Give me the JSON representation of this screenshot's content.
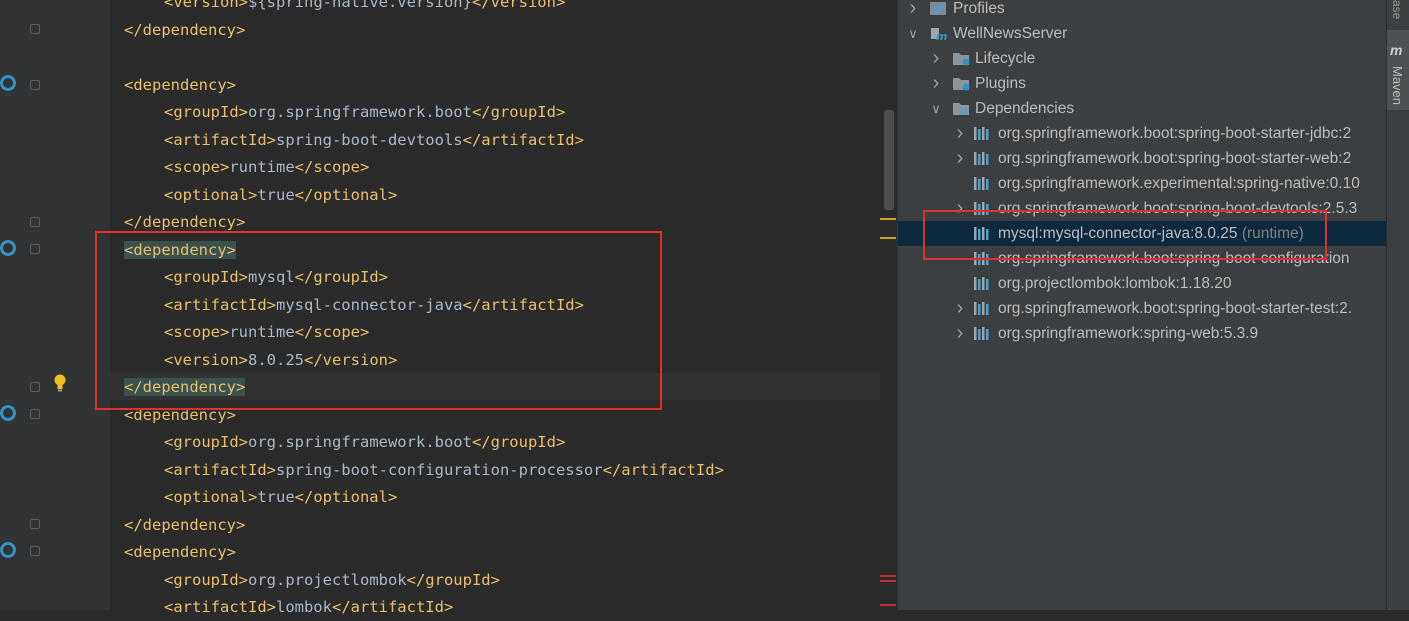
{
  "editor": {
    "lines": [
      {
        "indent": 2,
        "open": "<version>",
        "text": "${spring-native.version}",
        "close": "</version>"
      },
      {
        "indent": 1,
        "open": "",
        "text": "",
        "close": "</dependency>"
      },
      {
        "indent": 1,
        "open": "",
        "text": "",
        "close": ""
      },
      {
        "indent": 1,
        "open": "<dependency>",
        "text": "",
        "close": ""
      },
      {
        "indent": 2,
        "open": "<groupId>",
        "text": "org.springframework.boot",
        "close": "</groupId>"
      },
      {
        "indent": 2,
        "open": "<artifactId>",
        "text": "spring-boot-devtools",
        "close": "</artifactId>"
      },
      {
        "indent": 2,
        "open": "<scope>",
        "text": "runtime",
        "close": "</scope>"
      },
      {
        "indent": 2,
        "open": "<optional>",
        "text": "true",
        "close": "</optional>"
      },
      {
        "indent": 1,
        "open": "",
        "text": "",
        "close": "</dependency>"
      },
      {
        "indent": 1,
        "open": "<dependency>",
        "text": "",
        "close": ""
      },
      {
        "indent": 2,
        "open": "<groupId>",
        "text": "mysql",
        "close": "</groupId>"
      },
      {
        "indent": 2,
        "open": "<artifactId>",
        "text": "mysql-connector-java",
        "close": "</artifactId>"
      },
      {
        "indent": 2,
        "open": "<scope>",
        "text": "runtime",
        "close": "</scope>"
      },
      {
        "indent": 2,
        "open": "<version>",
        "text": "8.0.25",
        "close": "</version>"
      },
      {
        "indent": 1,
        "open": "",
        "text": "",
        "close": "</dependency>"
      },
      {
        "indent": 1,
        "open": "<dependency>",
        "text": "",
        "close": ""
      },
      {
        "indent": 2,
        "open": "<groupId>",
        "text": "org.springframework.boot",
        "close": "</groupId>"
      },
      {
        "indent": 2,
        "open": "<artifactId>",
        "text": "spring-boot-configuration-processor",
        "close": "</artifactId>"
      },
      {
        "indent": 2,
        "open": "<optional>",
        "text": "true",
        "close": "</optional>"
      },
      {
        "indent": 1,
        "open": "",
        "text": "",
        "close": "</dependency>"
      },
      {
        "indent": 1,
        "open": "<dependency>",
        "text": "",
        "close": ""
      },
      {
        "indent": 2,
        "open": "<groupId>",
        "text": "org.projectlombok",
        "close": "</groupId>"
      },
      {
        "indent": 2,
        "open": "<artifactId>",
        "text": "lombok",
        "close": "</artifactId>"
      }
    ]
  },
  "maven": {
    "tool_window_title": "Maven",
    "edge_label": "ase",
    "tree": [
      {
        "level": 0,
        "expander": "closed",
        "icon": "profiles-icon",
        "label": "Profiles",
        "suffix": ""
      },
      {
        "level": 0,
        "expander": "open",
        "icon": "maven-project-icon",
        "label": "WellNewsServer",
        "suffix": ""
      },
      {
        "level": 1,
        "expander": "closed",
        "icon": "lifecycle-folder-icon",
        "label": "Lifecycle",
        "suffix": ""
      },
      {
        "level": 1,
        "expander": "closed",
        "icon": "plugins-folder-icon",
        "label": "Plugins",
        "suffix": ""
      },
      {
        "level": 1,
        "expander": "open",
        "icon": "dependencies-folder-icon",
        "label": "Dependencies",
        "suffix": ""
      },
      {
        "level": 2,
        "expander": "closed",
        "icon": "library-icon",
        "label": "org.springframework.boot:spring-boot-starter-jdbc:2",
        "suffix": ""
      },
      {
        "level": 2,
        "expander": "closed",
        "icon": "library-icon",
        "label": "org.springframework.boot:spring-boot-starter-web:2",
        "suffix": ""
      },
      {
        "level": 2,
        "expander": "none",
        "icon": "library-icon",
        "label": "org.springframework.experimental:spring-native:0.10",
        "suffix": ""
      },
      {
        "level": 2,
        "expander": "closed",
        "icon": "library-icon",
        "label": "org.springframework.boot:spring-boot-devtools:2.5.3",
        "suffix": ""
      },
      {
        "level": 2,
        "expander": "none",
        "icon": "library-icon",
        "label": "mysql:mysql-connector-java:8.0.25",
        "suffix": "(runtime)",
        "selected": true
      },
      {
        "level": 2,
        "expander": "none",
        "icon": "library-icon",
        "label": "org.springframework.boot:spring-boot-configuration",
        "suffix": ""
      },
      {
        "level": 2,
        "expander": "none",
        "icon": "library-icon",
        "label": "org.projectlombok:lombok:1.18.20",
        "suffix": ""
      },
      {
        "level": 2,
        "expander": "closed",
        "icon": "library-icon",
        "label": "org.springframework.boot:spring-boot-starter-test:2.",
        "suffix": ""
      },
      {
        "level": 2,
        "expander": "closed",
        "icon": "library-icon",
        "label": "org.springframework:spring-web:5.3.9",
        "suffix": ""
      }
    ]
  },
  "colors": {
    "editor_bg": "#2b2b2b",
    "tag": "#e8bf6a",
    "text": "#a9b7c6",
    "tree_bg": "#3c3f41",
    "selection": "#0d293e",
    "annotation_red": "#e0302a"
  }
}
